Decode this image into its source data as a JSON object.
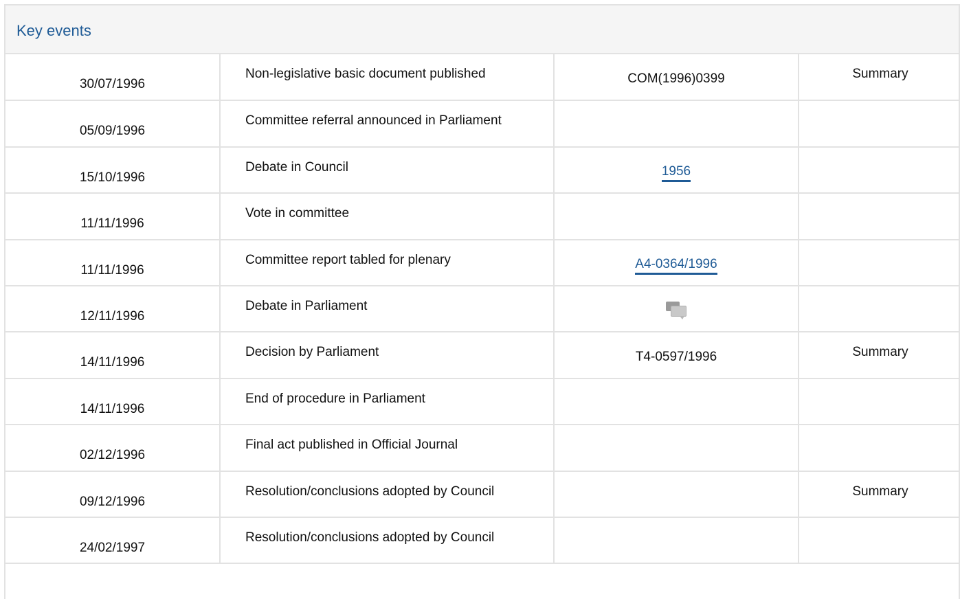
{
  "panel": {
    "title": "Key events"
  },
  "events": [
    {
      "date": "30/07/1996",
      "event": "Non-legislative basic document published",
      "reference": "COM(1996)0399",
      "reference_link": false,
      "summary": "Summary"
    },
    {
      "date": "05/09/1996",
      "event": "Committee referral announced in Parliament",
      "reference": "",
      "reference_link": false,
      "summary": ""
    },
    {
      "date": "15/10/1996",
      "event": "Debate in Council",
      "reference": "1956",
      "reference_link": true,
      "summary": ""
    },
    {
      "date": "11/11/1996",
      "event": "Vote in committee",
      "reference": "",
      "reference_link": false,
      "summary": ""
    },
    {
      "date": "11/11/1996",
      "event": "Committee report tabled for plenary",
      "reference": "A4-0364/1996",
      "reference_link": true,
      "summary": ""
    },
    {
      "date": "12/11/1996",
      "event": "Debate in Parliament",
      "reference": "",
      "reference_link": false,
      "reference_icon": "debate-icon",
      "summary": ""
    },
    {
      "date": "14/11/1996",
      "event": "Decision by Parliament",
      "reference": "T4-0597/1996",
      "reference_link": false,
      "summary": "Summary"
    },
    {
      "date": "14/11/1996",
      "event": "End of procedure in Parliament",
      "reference": "",
      "reference_link": false,
      "summary": ""
    },
    {
      "date": "02/12/1996",
      "event": "Final act published in Official Journal",
      "reference": "",
      "reference_link": false,
      "summary": ""
    },
    {
      "date": "09/12/1996",
      "event": "Resolution/conclusions adopted by Council",
      "reference": "",
      "reference_link": false,
      "summary": "Summary"
    },
    {
      "date": "24/02/1997",
      "event": "Resolution/conclusions adopted by Council",
      "reference": "",
      "reference_link": false,
      "summary": ""
    }
  ],
  "colors": {
    "link": "#1f5b96",
    "border": "#e2e2e2",
    "header_bg": "#f5f5f5"
  }
}
